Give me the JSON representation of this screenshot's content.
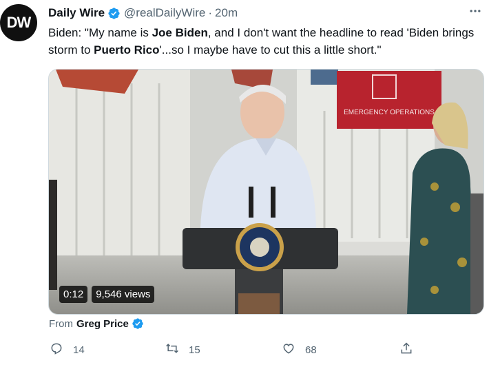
{
  "author": {
    "avatar_text": "DW",
    "display_name": "Daily Wire",
    "handle": "@realDailyWire",
    "separator": "·",
    "time": "20m"
  },
  "tweet": {
    "segments": [
      {
        "text": "Biden: \"My name is ",
        "bold": false
      },
      {
        "text": "Joe Biden",
        "bold": true
      },
      {
        "text": ", and I don't want the headline to read 'Biden brings storm to ",
        "bold": false
      },
      {
        "text": "Puerto Rico",
        "bold": true
      },
      {
        "text": "'...so I maybe have to cut this a little short.\"",
        "bold": false
      }
    ]
  },
  "media": {
    "sign_text": "EMERGENCY OPERATIONS",
    "duration": "0:12",
    "views": "9,546 views"
  },
  "attribution": {
    "prefix": "From",
    "name": "Greg Price"
  },
  "actions": {
    "replies": "14",
    "retweets": "15",
    "likes": "68"
  },
  "colors": {
    "verified": "#1d9bf0",
    "secondary_text": "#536471",
    "primary_text": "#0f1419",
    "sign_red": "#b8232e"
  },
  "icons": [
    "verified-badge-icon",
    "more-icon",
    "reply-icon",
    "retweet-icon",
    "like-icon",
    "share-icon"
  ]
}
